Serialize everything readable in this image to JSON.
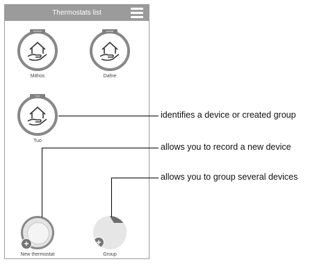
{
  "header": {
    "title": "Thermostats list",
    "menu_icon": "hamburger-menu-icon"
  },
  "devices": [
    {
      "label": "Mithos",
      "tag": "MITHOS",
      "icon": "house-hand-icon"
    },
    {
      "label": "Dafne",
      "tag": "DAFNE",
      "icon": "house-hand-icon"
    },
    {
      "label": "Tuo",
      "tag": "TUO",
      "icon": "house-hand-icon"
    }
  ],
  "actions": [
    {
      "label": "New thermostat",
      "icon": "thermostat-knob-icon"
    },
    {
      "label": "Group",
      "icon": "folder-icon"
    }
  ],
  "annotations": [
    "identifies a device or created group",
    "allows you to record a new device",
    "allows you to group several devices"
  ],
  "colors": {
    "titlebar": "#9b9b9b",
    "ring": "#888888",
    "plus": "#767676"
  }
}
